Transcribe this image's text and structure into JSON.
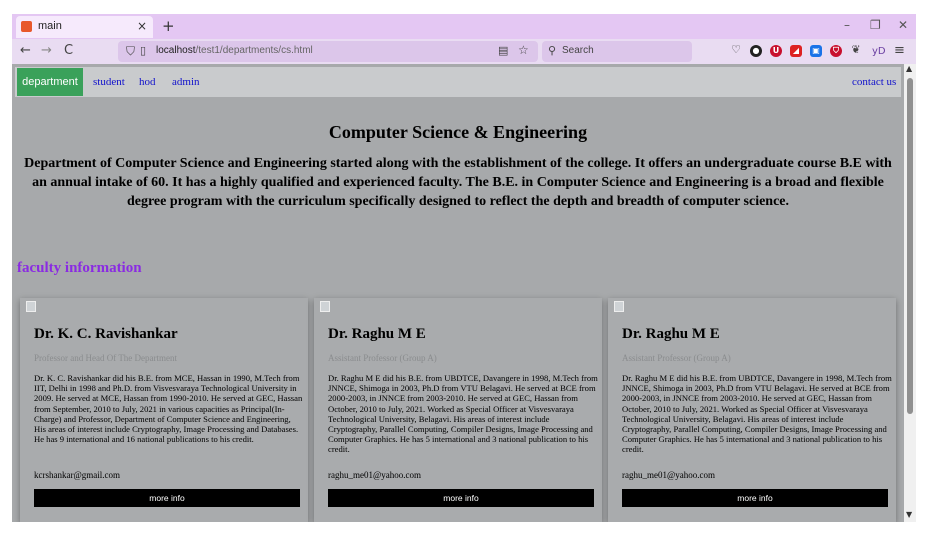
{
  "browser": {
    "tab_title": "main",
    "tab_close": "×",
    "new_tab": "+",
    "win_min": "–",
    "win_max": "❐",
    "win_close": "✕",
    "back": "←",
    "forward": "→",
    "reload": "C",
    "url_host": "localhost",
    "url_path": "/test1/departments/cs.html",
    "search_placeholder": "Search",
    "menu": "≡",
    "profile_text": "yD"
  },
  "site_nav": {
    "active": "department",
    "links": [
      "student",
      "hod",
      "admin"
    ],
    "contact": "contact us"
  },
  "page": {
    "title": "Computer Science & Engineering",
    "description": "Department of Computer Science and Engineering started along with the establishment of the college. It offers an undergraduate course B.E with an annual intake of 60. It has a highly qualified and experienced faculty. The B.E. in Computer Science and Engineering is a broad and flexible degree program with the curriculum specifically designed to reflect the depth and breadth of computer science.",
    "faculty_heading": "faculty information"
  },
  "faculty": [
    {
      "name": "Dr. K. C. Ravishankar",
      "title": "Professor and Head Of The Department",
      "bio": "Dr. K. C. Ravishankar did his B.E. from MCE, Hassan in 1990, M.Tech from IIT, Delhi in 1998 and Ph.D. from Visvesvaraya Technological University in 2009. He served at MCE, Hassan from 1990-2010. He served at GEC, Hassan from September, 2010 to July, 2021 in various capacities as Principal(In-Charge) and Professor, Department of Computer Science and Engineering, His areas of interest include Cryptography, Image Processing and Databases. He has 9 international and 16 national publications to his credit.",
      "email": "kcrshankar@gmail.com",
      "button": "more info"
    },
    {
      "name": "Dr. Raghu M E",
      "title": "Assistant Professor (Group A)",
      "bio": "Dr. Raghu M E did his B.E. from UBDTCE, Davangere in 1998, M.Tech from JNNCE, Shimoga in 2003, Ph.D from VTU Belagavi. He served at BCE from 2000-2003, in JNNCE from 2003-2010. He served at GEC, Hassan from October, 2010 to July, 2021. Worked as Special Officer at Visvesvaraya Technological University, Belagavi. His areas of interest include Cryptography, Parallel Computing, Compiler Designs, Image Processing and Computer Graphics. He has 5 international and 3 national publication to his credit.",
      "email": "raghu_me01@yahoo.com",
      "button": "more info"
    },
    {
      "name": "Dr. Raghu M E",
      "title": "Assistant Professor (Group A)",
      "bio": "Dr. Raghu M E did his B.E. from UBDTCE, Davangere in 1998, M.Tech from JNNCE, Shimoga in 2003, Ph.D from VTU Belagavi. He served at BCE from 2000-2003, in JNNCE from 2003-2010. He served at GEC, Hassan from October, 2010 to July, 2021. Worked as Special Officer at Visvesvaraya Technological University, Belagavi. His areas of interest include Cryptography, Parallel Computing, Compiler Designs, Image Processing and Computer Graphics. He has 5 international and 3 national publication to his credit.",
      "email": "raghu_me01@yahoo.com",
      "button": "more info"
    }
  ],
  "colors": {
    "page_bg": "#a7a9ab",
    "nav_active": "#3aa15a",
    "faculty_heading": "#8a2be2",
    "browser_chrome": "#e4c7f3"
  },
  "icons": [
    "back-icon",
    "forward-icon",
    "reload-icon",
    "shield-icon",
    "page-icon",
    "reader-icon",
    "star-icon",
    "search-icon",
    "menu-icon"
  ]
}
